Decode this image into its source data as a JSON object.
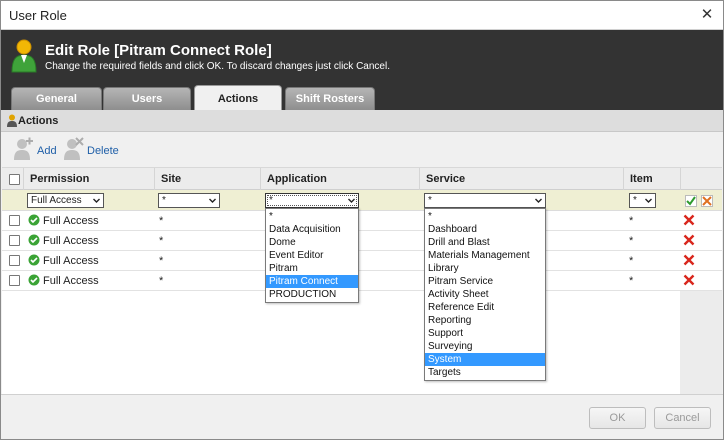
{
  "window": {
    "title": "User Role"
  },
  "header": {
    "title": "Edit Role [Pitram Connect Role]",
    "subtitle": "Change the required fields and click OK. To discard changes just click Cancel."
  },
  "tabs": [
    {
      "label": "General",
      "active": false
    },
    {
      "label": "Users",
      "active": false
    },
    {
      "label": "Actions",
      "active": true
    },
    {
      "label": "Shift Rosters",
      "active": false
    }
  ],
  "section": {
    "label": "Actions"
  },
  "toolbar": {
    "add_label": "Add",
    "delete_label": "Delete"
  },
  "grid": {
    "columns": [
      "Permission",
      "Site",
      "Application",
      "Service",
      "Item"
    ],
    "edit_row": {
      "permission": "Full Access",
      "site": "*",
      "application": "*",
      "service": "*",
      "item": "*"
    },
    "rows": [
      {
        "permission": "Full Access",
        "site": "*",
        "item": "*"
      },
      {
        "permission": "Full Access",
        "site": "*",
        "item": "*"
      },
      {
        "permission": "Full Access",
        "site": "*",
        "item": "*"
      },
      {
        "permission": "Full Access",
        "site": "*",
        "item": "*"
      }
    ]
  },
  "application_dropdown": {
    "options": [
      "*",
      "Data Acquisition",
      "Dome",
      "Event Editor",
      "Pitram",
      "Pitram Connect",
      "PRODUCTION"
    ],
    "highlighted": "Pitram Connect"
  },
  "service_dropdown": {
    "options": [
      "*",
      "Dashboard",
      "Drill and Blast",
      "Materials Management",
      "Library",
      "Pitram Service",
      "Activity Sheet",
      "Reference Edit",
      "Reporting",
      "Support",
      "Surveying",
      "System",
      "Targets"
    ],
    "highlighted": "System"
  },
  "footer": {
    "ok_label": "OK",
    "cancel_label": "Cancel"
  },
  "colors": {
    "header_bg": "#333333",
    "edit_row_bg": "#efefd3",
    "highlight": "#3399ff",
    "link": "#1f5fa8",
    "ok_green": "#3aa335",
    "delete_red": "#d9261c"
  }
}
